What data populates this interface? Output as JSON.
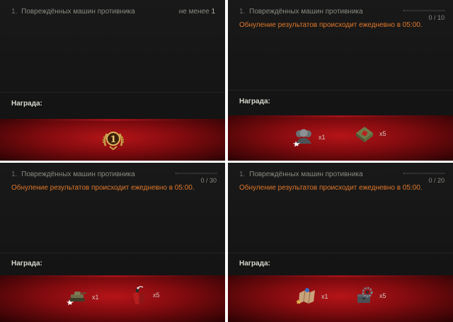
{
  "panels": [
    {
      "task_number": "1.",
      "task_name": "Повреждённых машин противника",
      "requirement_prefix": "не менее",
      "requirement_value": "1",
      "reward_label": "Награда:",
      "rewards": [
        {
          "icon": "medal-1-icon",
          "quantity": ""
        }
      ]
    },
    {
      "task_number": "1.",
      "task_name": "Повреждённых машин противника",
      "progress_text": "0 / 10",
      "progress_fraction": 0,
      "reset_notice": "Обнуление результатов происходит ежедневно в 05:00.",
      "reward_label": "Награда:",
      "rewards": [
        {
          "icon": "crew-icon",
          "quantity": "x1"
        },
        {
          "icon": "first-aid-kit-icon",
          "quantity": "x5"
        }
      ]
    },
    {
      "task_number": "1.",
      "task_name": "Повреждённых машин противника",
      "progress_text": "0 / 30",
      "progress_fraction": 0,
      "reset_notice": "Обнуление результатов происходит ежедневно в 05:00.",
      "reward_label": "Награда:",
      "rewards": [
        {
          "icon": "tank-icon",
          "quantity": "x1"
        },
        {
          "icon": "fire-extinguisher-icon",
          "quantity": "x5"
        }
      ]
    },
    {
      "task_number": "1.",
      "task_name": "Повреждённых машин противника",
      "progress_text": "0 / 20",
      "progress_fraction": 0,
      "reset_notice": "Обнуление результатов происходит ежедневно в 05:00.",
      "reward_label": "Награда:",
      "rewards": [
        {
          "icon": "map-icon",
          "quantity": "x1"
        },
        {
          "icon": "repair-kit-icon",
          "quantity": "x5"
        }
      ]
    }
  ],
  "colors": {
    "reset_text": "#e0782b",
    "reward_strip": "#a01218",
    "panel_bg": "#171717"
  }
}
